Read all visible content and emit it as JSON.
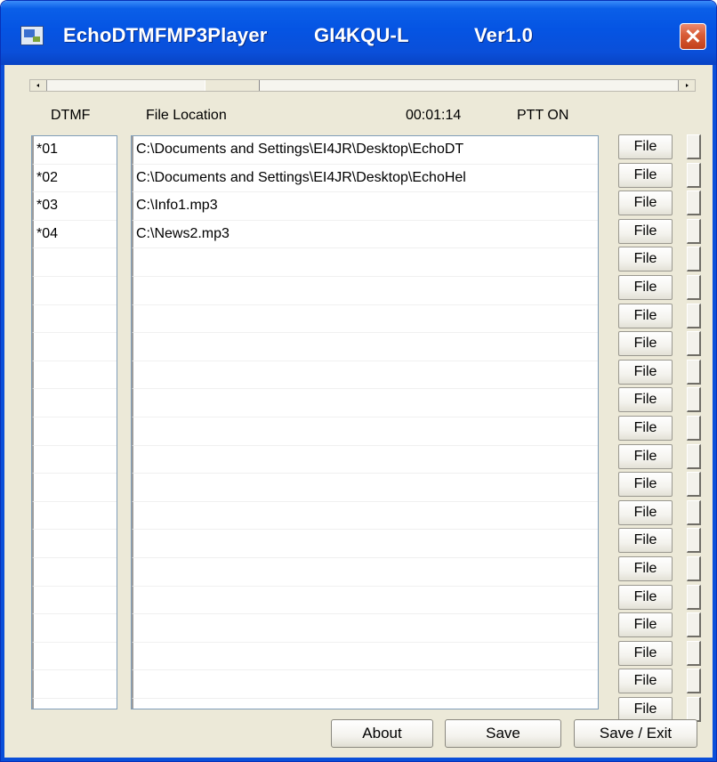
{
  "window": {
    "title_app": "EchoDTMFMP3Player",
    "title_callsign": "GI4KQU-L",
    "title_version": "Ver1.0"
  },
  "header": {
    "dtmf_label": "DTMF",
    "file_location_label": "File Location",
    "time": "00:01:14",
    "ptt_status": "PTT ON"
  },
  "dtmf_codes": [
    "*01",
    "*02",
    "*03",
    "*04",
    "",
    "",
    "",
    "",
    "",
    "",
    "",
    "",
    "",
    "",
    "",
    "",
    "",
    "",
    "",
    "",
    ""
  ],
  "file_paths": [
    "C:\\Documents and Settings\\EI4JR\\Desktop\\EchoDT",
    "C:\\Documents and Settings\\EI4JR\\Desktop\\EchoHel",
    "C:\\Info1.mp3",
    "C:\\News2.mp3",
    "",
    "",
    "",
    "",
    "",
    "",
    "",
    "",
    "",
    "",
    "",
    "",
    "",
    "",
    "",
    "",
    ""
  ],
  "file_button_label": "File",
  "buttons": {
    "about": "About",
    "save": "Save",
    "save_exit": "Save / Exit"
  },
  "colors": {
    "titlebar": "#0554e3",
    "close_button": "#d85b35",
    "window_face": "#ece9d8",
    "list_border": "#7f9db9"
  }
}
